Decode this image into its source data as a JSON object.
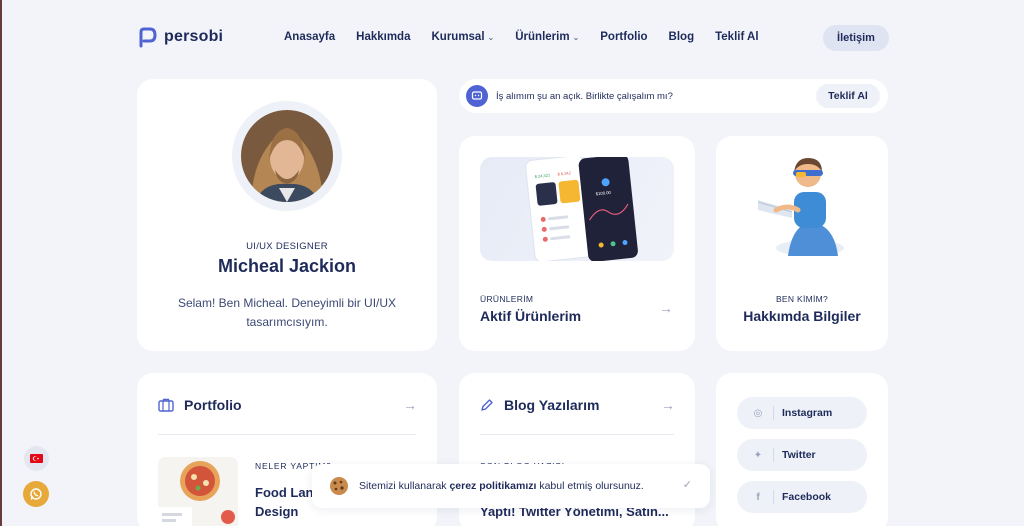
{
  "brand": {
    "name": "persobi",
    "color": "#4f63d2"
  },
  "nav": {
    "items": [
      {
        "label": "Anasayfa",
        "has_dropdown": false
      },
      {
        "label": "Hakkımda",
        "has_dropdown": false
      },
      {
        "label": "Kurumsal",
        "has_dropdown": true
      },
      {
        "label": "Ürünlerim",
        "has_dropdown": true
      },
      {
        "label": "Portfolio",
        "has_dropdown": false
      },
      {
        "label": "Blog",
        "has_dropdown": false
      },
      {
        "label": "Teklif Al",
        "has_dropdown": false
      }
    ],
    "contact_label": "İletişim"
  },
  "profile": {
    "role": "UI/UX DESIGNER",
    "name": "Micheal Jackion",
    "bio": "Selam! Ben Micheal. Deneyimli bir UI/UX tasarımcısıyım."
  },
  "jobbar": {
    "text": "İş alımım şu an açık. Birlikte çalışalım mı?",
    "button_label": "Teklif Al"
  },
  "products": {
    "label": "ÜRÜNLERİM",
    "title": "Aktif Ürünlerim",
    "mockup_values": [
      "$ 24,321",
      "$ 6,342",
      "$100.00"
    ]
  },
  "about": {
    "label": "BEN KİMİM?",
    "title": "Hakkımda Bilgiler"
  },
  "portfolio": {
    "title": "Portfolio",
    "item_label": "NELER YAPTIM?",
    "item_title_1": "Food Land",
    "item_title_2": "Design"
  },
  "blog": {
    "title": "Blog Yazılarım",
    "item_label": "SON BLOG YAZISI",
    "item_title": "Yaptı! Twitter Yönetimi, Satın..."
  },
  "social": {
    "items": [
      {
        "label": "Instagram",
        "icon": "instagram-icon"
      },
      {
        "label": "Twitter",
        "icon": "twitter-icon"
      },
      {
        "label": "Facebook",
        "icon": "facebook-icon"
      }
    ]
  },
  "cookie": {
    "text_before": "Sitemizi kullanarak ",
    "link_text": "çerez politikamızı",
    "text_after": " kabul etmiş olursunuz."
  },
  "floating": {
    "language": "TR",
    "whatsapp_color": "#e6a93a"
  }
}
